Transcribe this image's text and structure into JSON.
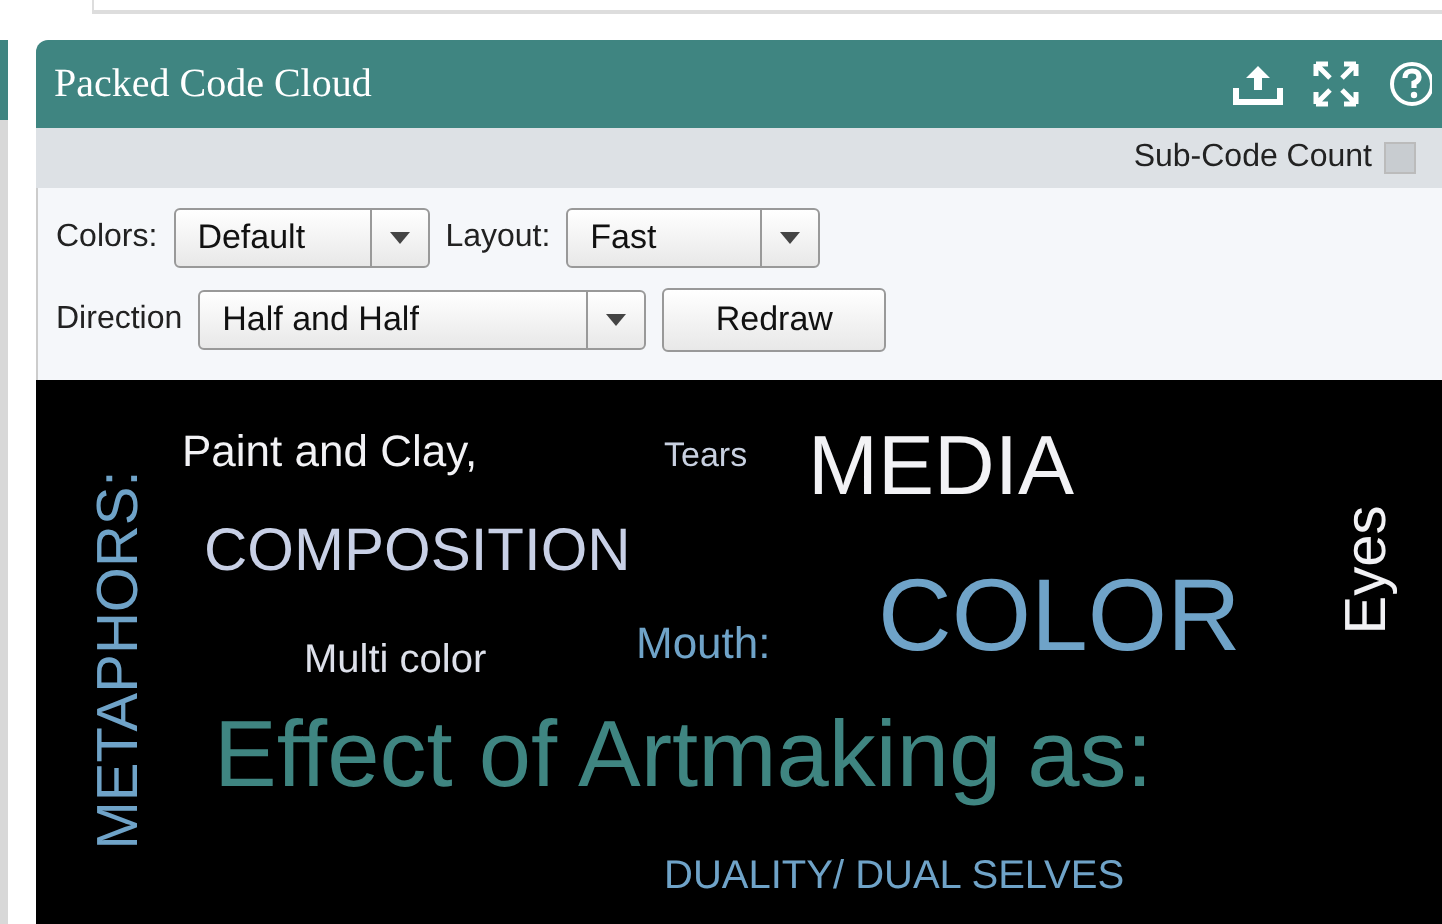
{
  "panel": {
    "title": "Packed Code Cloud"
  },
  "sub_code_count": {
    "label": "Sub-Code Count",
    "checked": false
  },
  "controls": [
    {
      "label": "Colors:",
      "value": "Default"
    },
    {
      "label": "Layout:",
      "value": "Fast"
    },
    {
      "label": "Direction",
      "value": "Half and Half"
    }
  ],
  "redraw_button": "Redraw",
  "cloud": [
    {
      "text": "METAPHORS:",
      "kind": "vertical",
      "color": "#6fa3c8"
    },
    {
      "text": "Paint and Clay,",
      "kind": "horizontal",
      "color": "#f2f2f5"
    },
    {
      "text": "Tears",
      "kind": "horizontal",
      "color": "#c8d0e0"
    },
    {
      "text": "MEDIA",
      "kind": "horizontal",
      "color": "#f2f2f5"
    },
    {
      "text": "COMPOSITION",
      "kind": "horizontal",
      "color": "#c8d0e6"
    },
    {
      "text": "COLOR",
      "kind": "horizontal",
      "color": "#6fa3c8"
    },
    {
      "text": "Eyes",
      "kind": "vertical",
      "color": "#f2f2f5"
    },
    {
      "text": "Multi color",
      "kind": "horizontal",
      "color": "#dde0ea"
    },
    {
      "text": "Mouth:",
      "kind": "horizontal",
      "color": "#6fa3c8"
    },
    {
      "text": "Effect of Artmaking as:",
      "kind": "horizontal",
      "color": "#3f8581"
    },
    {
      "text": "DUALITY/ DUAL SELVES",
      "kind": "horizontal",
      "color": "#6fa3c8"
    }
  ]
}
